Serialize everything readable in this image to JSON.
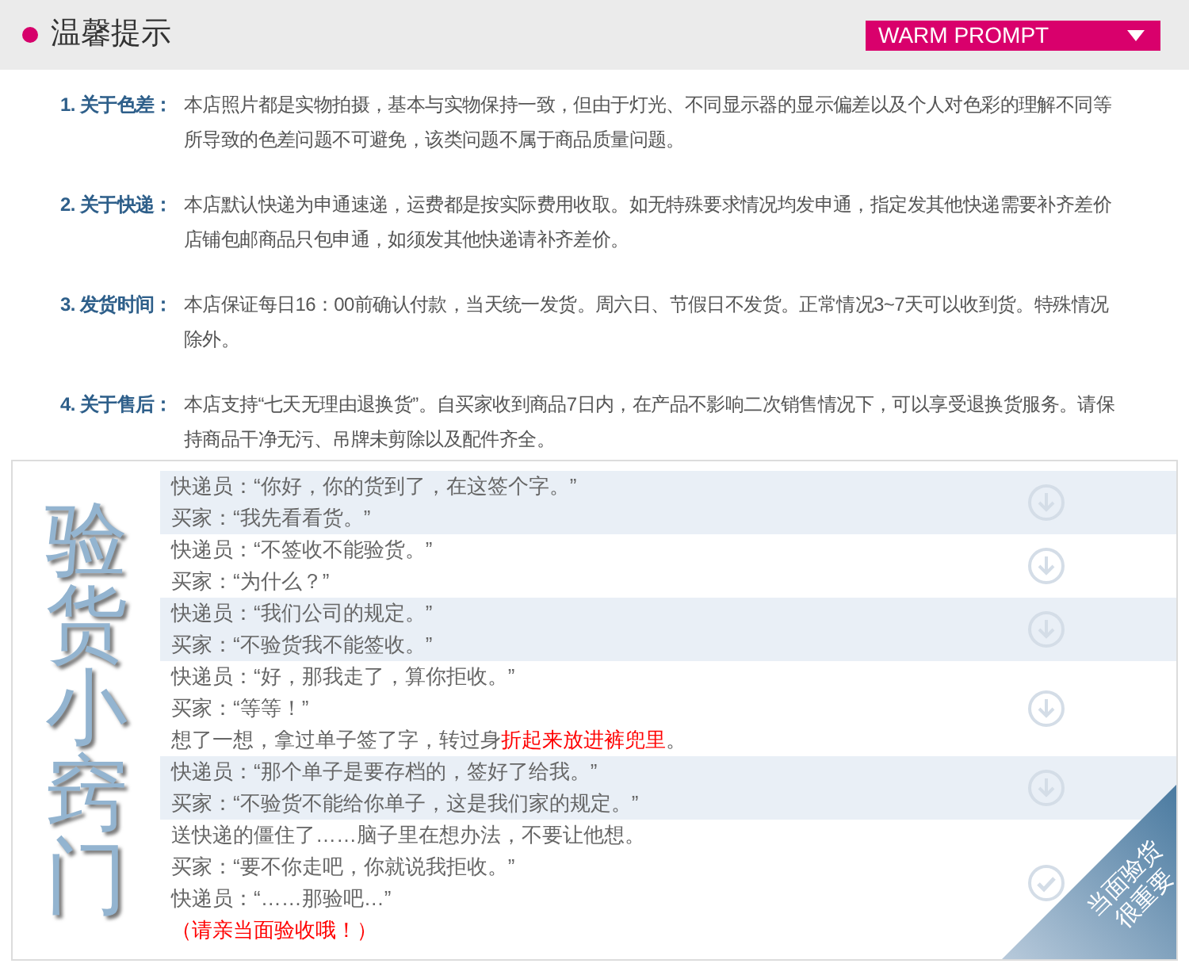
{
  "header": {
    "title": "温馨提示",
    "badge": "WARM PROMPT"
  },
  "notes": [
    {
      "label": "1. 关于色差：",
      "text": "本店照片都是实物拍摄，基本与实物保持一致，但由于灯光、不同显示器的显示偏差以及个人对色彩的理解不同等所导致的色差问题不可避免，该类问题不属于商品质量问题。"
    },
    {
      "label": "2. 关于快递：",
      "text": "本店默认快递为申通速递，运费都是按实际费用收取。如无特殊要求情况均发申通，指定发其他快递需要补齐差价店铺包邮商品只包申通，如须发其他快递请补齐差价。"
    },
    {
      "label": "3. 发货时间：",
      "text": "本店保证每日16：00前确认付款，当天统一发货。周六日、节假日不发货。正常情况3~7天可以收到货。特殊情况除外。"
    },
    {
      "label": "4. 关于售后：",
      "text": "本店支持“七天无理由退换货”。自买家收到商品7日内，在产品不影响二次销售情况下，可以享受退换货服务。请保持商品干净无污、吊牌未剪除以及配件齐全。"
    }
  ],
  "tips": {
    "title": "验货小窍门",
    "ribbon": [
      "当面验货",
      "很重要"
    ],
    "blocks": [
      {
        "shaded": true,
        "kind": "down",
        "lines": [
          {
            "parts": [
              {
                "text": "快递员：“你好，你的货到了，在这签个字。”",
                "highlight": false
              }
            ]
          },
          {
            "parts": [
              {
                "text": "买家：“我先看看货。”",
                "highlight": false
              }
            ]
          }
        ]
      },
      {
        "shaded": false,
        "kind": "down",
        "lines": [
          {
            "parts": [
              {
                "text": "快递员：“不签收不能验货。”",
                "highlight": false
              }
            ]
          },
          {
            "parts": [
              {
                "text": "买家：“为什么？”",
                "highlight": false
              }
            ]
          }
        ]
      },
      {
        "shaded": true,
        "kind": "down",
        "lines": [
          {
            "parts": [
              {
                "text": "快递员：“我们公司的规定。”",
                "highlight": false
              }
            ]
          },
          {
            "parts": [
              {
                "text": "买家：“不验货我不能签收。”",
                "highlight": false
              }
            ]
          }
        ]
      },
      {
        "shaded": false,
        "kind": "down",
        "lines": [
          {
            "parts": [
              {
                "text": "快递员：“好，那我走了，算你拒收。”",
                "highlight": false
              }
            ]
          },
          {
            "parts": [
              {
                "text": "买家：“等等！”",
                "highlight": false
              }
            ]
          },
          {
            "parts": [
              {
                "text": "想了一想，拿过单子签了字，转过身",
                "highlight": false
              },
              {
                "text": "折起来放进裤兜里",
                "highlight": true
              },
              {
                "text": "。",
                "highlight": false
              }
            ]
          }
        ]
      },
      {
        "shaded": true,
        "kind": "down",
        "lines": [
          {
            "parts": [
              {
                "text": "快递员：“那个单子是要存档的，签好了给我。”",
                "highlight": false
              }
            ]
          },
          {
            "parts": [
              {
                "text": "买家：“不验货不能给你单子，这是我们家的规定。”",
                "highlight": false
              }
            ]
          }
        ]
      },
      {
        "shaded": false,
        "kind": "check",
        "lines": [
          {
            "parts": [
              {
                "text": "送快递的僵住了……脑子里在想办法，不要让他想。",
                "highlight": false
              }
            ]
          },
          {
            "parts": [
              {
                "text": "买家：“要不你走吧，你就说我拒收。”",
                "highlight": false
              }
            ]
          },
          {
            "parts": [
              {
                "text": "快递员：“……那验吧…”",
                "highlight": false
              }
            ]
          },
          {
            "parts": [
              {
                "text": "（请亲当面验收哦！）",
                "highlight": true
              }
            ]
          }
        ]
      }
    ]
  }
}
